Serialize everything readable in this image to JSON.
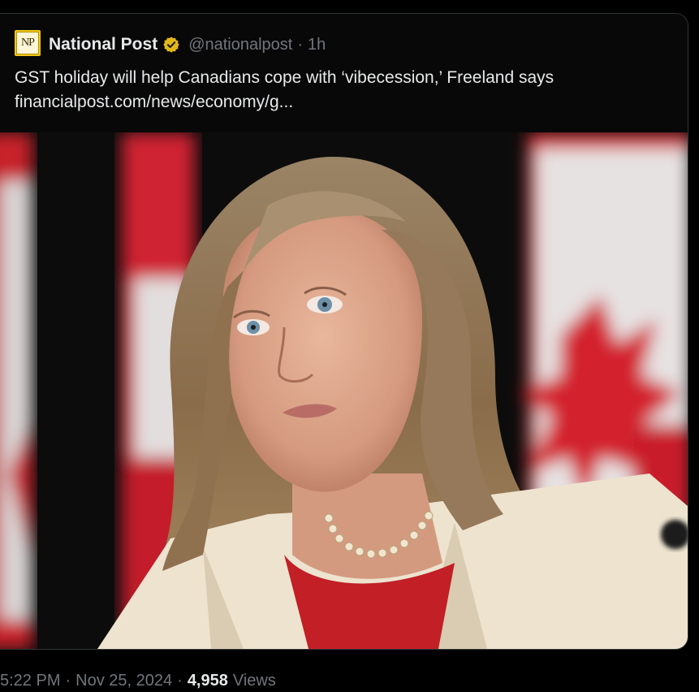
{
  "post": {
    "author_name": "National Post",
    "logo_text": "NP",
    "handle": "@nationalpost",
    "separator": "·",
    "relative_time": "1h",
    "text_line1": "GST holiday will help Canadians cope with ‘vibecession,’ Freeland says",
    "text_line2": "financialpost.com/news/economy/g...",
    "verified_icon": "verified-gold-badge-icon",
    "image_icon": "news-photo"
  },
  "footer": {
    "time": "5:22 PM",
    "separator": "·",
    "date": "Nov 25, 2024",
    "views_count": "4,958",
    "views_label": "Views"
  },
  "colors": {
    "background": "#000000",
    "text_primary": "#e7e9ea",
    "text_secondary": "#71767b",
    "verified_gold": "#e2b719",
    "flag_red": "#d21f2b"
  }
}
